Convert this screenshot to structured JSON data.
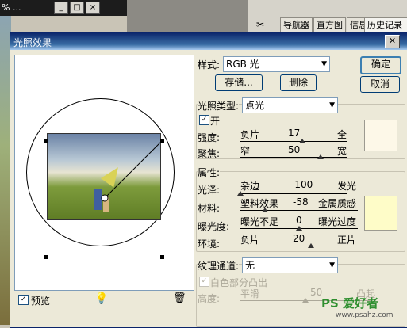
{
  "background": {
    "doc_title": "% ...",
    "panel_tabs": [
      "导航器",
      "直方图",
      "信息",
      "历史记录"
    ]
  },
  "dialog": {
    "title": "光照效果",
    "close_glyph": "✕",
    "style_label": "样式:",
    "style_value": "RGB 光",
    "save_button": "存储...",
    "delete_button": "删除",
    "ok_button": "确定",
    "cancel_button": "取消",
    "light_type_label": "光照类型:",
    "light_type_value": "点光",
    "on_label": "开",
    "on_checked": true,
    "intensity": {
      "label": "强度:",
      "left": "负片",
      "value": "17",
      "right": "全",
      "level_percent": 58
    },
    "focus": {
      "label": "聚焦:",
      "left": "窄",
      "value": "50",
      "right": "宽",
      "level_percent": 75
    },
    "properties_label": "属性:",
    "gloss": {
      "label": "光泽:",
      "left": "杂边",
      "value": "-100",
      "right": "发光",
      "level_percent": 0
    },
    "material": {
      "label": "材料:",
      "left": "塑料效果",
      "value": "-58",
      "right": "金属质感",
      "level_percent": 21
    },
    "exposure": {
      "label": "曝光度:",
      "left": "曝光不足",
      "value": "0",
      "right": "曝光过度",
      "level_percent": 50
    },
    "ambience": {
      "label": "环境:",
      "left": "负片",
      "value": "20",
      "right": "正片",
      "level_percent": 60
    },
    "texture_label": "纹理通道:",
    "texture_value": "无",
    "white_high_label": "白色部分凸出",
    "height": {
      "label": "高度:",
      "left": "平滑",
      "value": "50",
      "right": "凸起",
      "level_percent": 50
    },
    "preview_label": "预览",
    "preview_checked": true,
    "light_color": "#fdf8e8",
    "property_color": "#fefcc8"
  },
  "watermark": {
    "brand": "PS 爱好者",
    "url": "www.psahz.com"
  }
}
